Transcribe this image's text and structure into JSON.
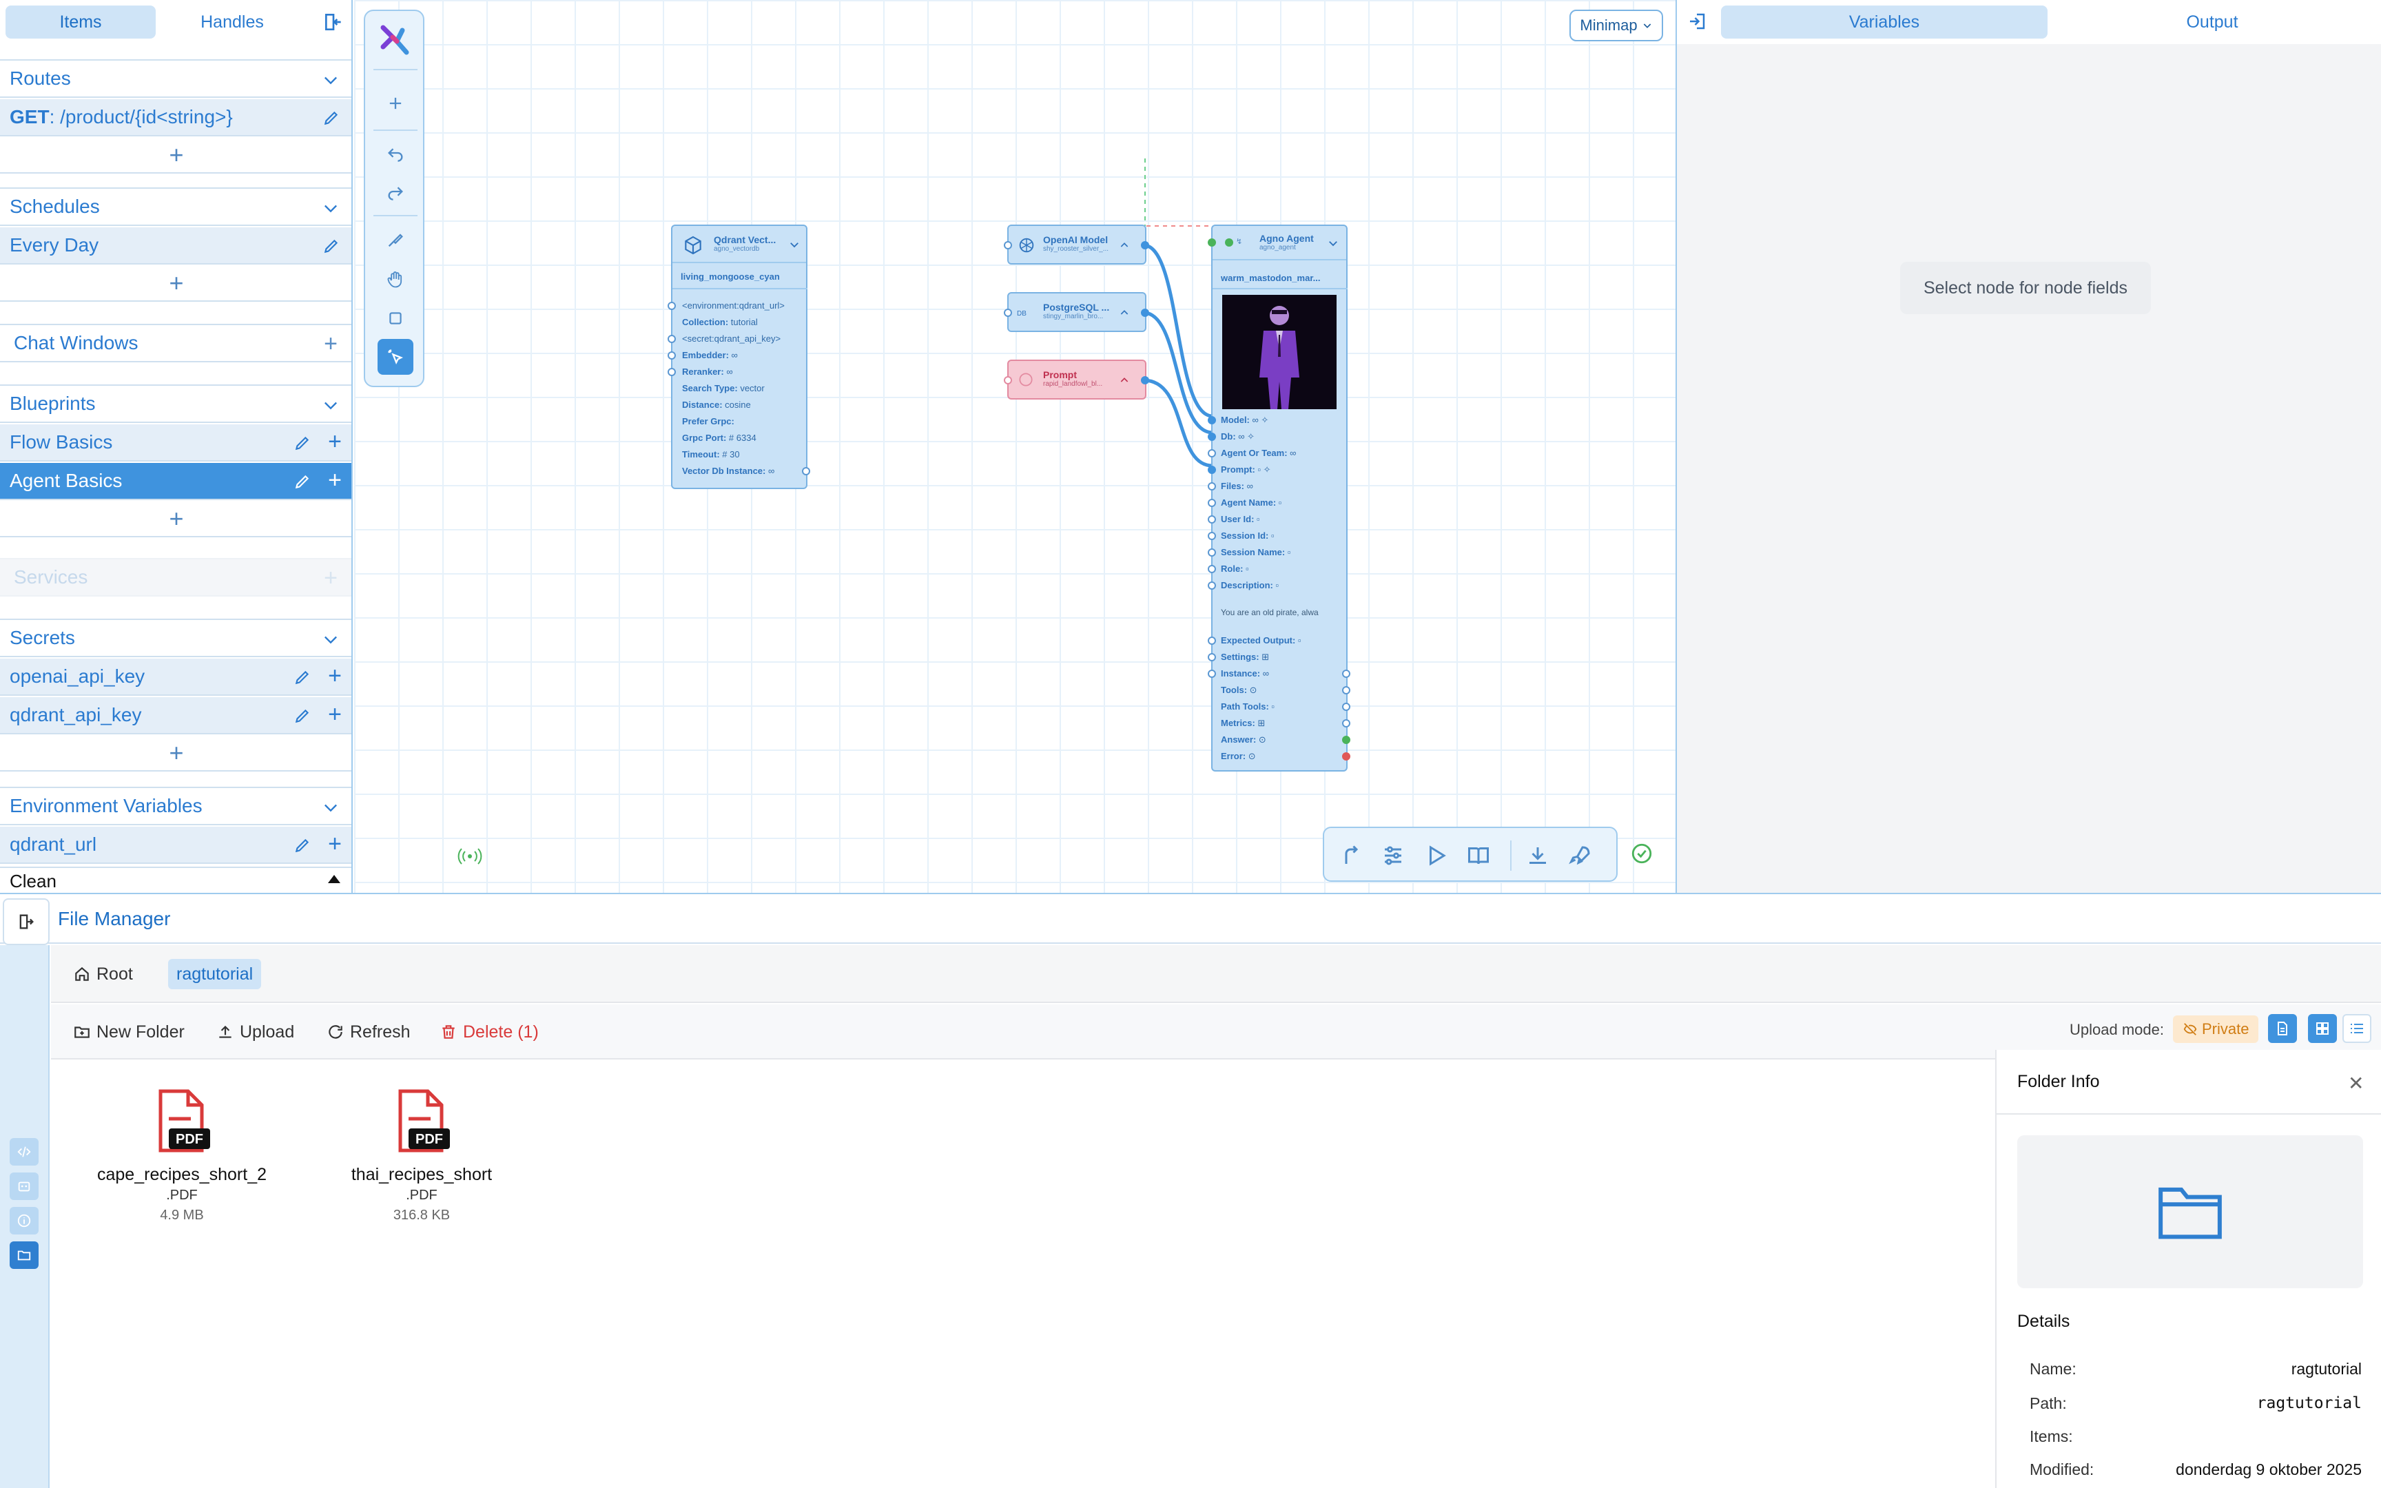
{
  "sidebar": {
    "tabs": [
      "Items",
      "Handles"
    ],
    "routes": {
      "title": "Routes",
      "items": [
        {
          "method": "GET",
          "path": ": /product/{id<string>}"
        }
      ]
    },
    "schedules": {
      "title": "Schedules",
      "items": [
        "Every Day"
      ]
    },
    "chat_windows": {
      "title": "Chat Windows"
    },
    "blueprints": {
      "title": "Blueprints",
      "items": [
        "Flow Basics",
        "Agent Basics"
      ]
    },
    "services": {
      "title": "Services"
    },
    "secrets": {
      "title": "Secrets",
      "items": [
        "openai_api_key",
        "qdrant_api_key"
      ]
    },
    "env_vars": {
      "title": "Environment Variables",
      "items": [
        "qdrant_url"
      ]
    },
    "status": "Clean"
  },
  "canvas": {
    "minimap_label": "Minimap",
    "nodes": {
      "qdrant": {
        "title": "Qdrant Vect...",
        "subtitle": "agno_vectordb",
        "name": "living_mongoose_cyan",
        "fields": [
          {
            "label": "",
            "value": "<environment:qdrant_url>"
          },
          {
            "label": "Collection:",
            "value": "tutorial"
          },
          {
            "label": "",
            "value": "<secret:qdrant_api_key>"
          },
          {
            "label": "Embedder:",
            "value": "∞"
          },
          {
            "label": "Reranker:",
            "value": "∞"
          },
          {
            "label": "Search Type:",
            "value": "vector"
          },
          {
            "label": "Distance:",
            "value": "cosine"
          },
          {
            "label": "Prefer Grpc:",
            "value": ""
          },
          {
            "label": "Grpc Port:",
            "value": "# 6334"
          },
          {
            "label": "Timeout:",
            "value": "# 30"
          },
          {
            "label": "Vector Db Instance:",
            "value": "∞"
          }
        ]
      },
      "openai": {
        "title": "OpenAI Model",
        "subtitle": "shy_rooster_silver_..."
      },
      "postgres": {
        "title": "PostgreSQL ...",
        "subtitle": "stingy_marlin_bro..."
      },
      "prompt": {
        "title": "Prompt",
        "subtitle": "rapid_landfowl_bl..."
      },
      "agent": {
        "title": "Agno Agent",
        "subtitle": "agno_agent",
        "name": "warm_mastodon_mar...",
        "fields": [
          "Model:",
          "Db:",
          "Agent Or Team:",
          "Prompt:",
          "Files:",
          "Agent Name:",
          "User Id:",
          "Session Id:",
          "Session Name:",
          "Role:",
          "Description:"
        ],
        "description_text": "You are an old pirate, alwa",
        "fields2": [
          "Expected Output:",
          "Settings:",
          "Instance:",
          "Tools:",
          "Path Tools:",
          "Metrics:",
          "Answer:",
          "Error:"
        ]
      }
    }
  },
  "right_panel": {
    "tabs": [
      "Variables",
      "Output"
    ],
    "empty_message": "Select node for node fields"
  },
  "file_manager": {
    "title": "File Manager",
    "breadcrumb": [
      "Root",
      "ragtutorial"
    ],
    "actions": {
      "new_folder": "New Folder",
      "upload": "Upload",
      "refresh": "Refresh",
      "delete": "Delete (1)"
    },
    "upload_mode_label": "Upload mode:",
    "upload_mode_value": "Private",
    "files": [
      {
        "name": "cape_recipes_short_2",
        "ext": ".PDF",
        "size": "4.9 MB",
        "badge": "PDF"
      },
      {
        "name": "thai_recipes_short",
        "ext": ".PDF",
        "size": "316.8 KB",
        "badge": "PDF"
      }
    ],
    "folder_info": {
      "title": "Folder Info",
      "details_title": "Details",
      "rows": [
        {
          "key": "Name:",
          "value": "ragtutorial"
        },
        {
          "key": "Path:",
          "value": "ragtutorial"
        },
        {
          "key": "Items:",
          "value": ""
        },
        {
          "key": "Modified:",
          "value": "donderdag 9 oktober 2025"
        }
      ]
    }
  },
  "colors": {
    "accent": "#3f93de",
    "node_fill": "#c9e2f7",
    "prompt_fill": "#f6c9d3",
    "danger": "#d93a3a"
  }
}
